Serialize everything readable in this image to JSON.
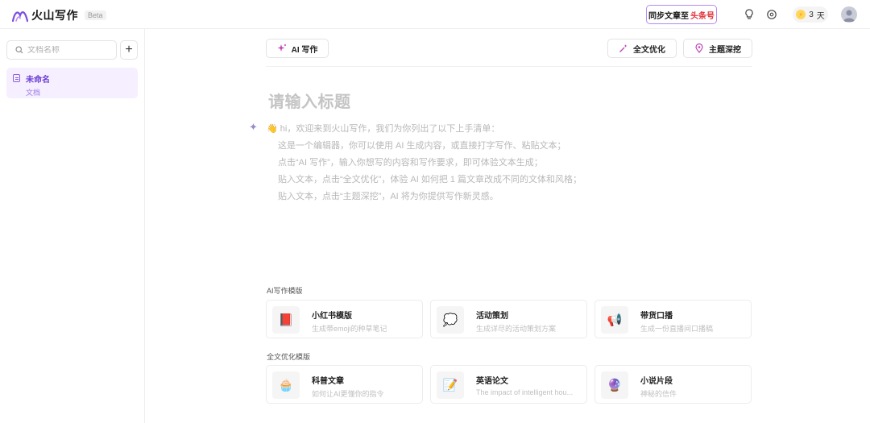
{
  "app": {
    "name": "火山写作",
    "badge": "Beta"
  },
  "header": {
    "sync_label": "同步文章至",
    "sync_target": "头条号",
    "days_count": "3",
    "days_unit": "天"
  },
  "sidebar": {
    "search_placeholder": "文档名称",
    "add_label": "+",
    "docs": [
      {
        "title": "未命名",
        "subtitle": "文档"
      }
    ]
  },
  "toolbar": {
    "ai_write": "AI 写作",
    "optimize": "全文优化",
    "topic": "主题深挖"
  },
  "editor": {
    "title_placeholder": "请输入标题",
    "intro_lines": [
      "hi，欢迎来到火山写作，我们为你列出了以下上手清单：",
      "这是一个编辑器，你可以使用 AI 生成内容，或直接打字写作、粘贴文本；",
      "点击“AI 写作”，输入你想写的内容和写作要求，即可体验文本生成；",
      "贴入文本，点击“全文优化”，体验 AI 如何把 1 篇文章改成不同的文体和风格；",
      "贴入文本，点击“主题深挖”，AI 将为你提供写作新灵感。"
    ]
  },
  "templates": {
    "ai_section": "AI写作模版",
    "ai_cards": [
      {
        "title": "小红书模版",
        "desc": "生成带emoji的种草笔记",
        "icon": "red-book-icon"
      },
      {
        "title": "活动策划",
        "desc": "生成详尽的活动策划方案",
        "icon": "chat-bubble-icon"
      },
      {
        "title": "带货口播",
        "desc": "生成一份直播间口播稿",
        "icon": "megaphone-icon"
      }
    ],
    "opt_section": "全文优化模版",
    "opt_cards": [
      {
        "title": "科普文章",
        "desc": "如何让AI更懂你的指令",
        "icon": "science-icon"
      },
      {
        "title": "英语论文",
        "desc": "The impact of intelligent hou...",
        "icon": "memo-icon"
      },
      {
        "title": "小说片段",
        "desc": "神秘的信件",
        "icon": "crystal-ball-icon"
      }
    ]
  },
  "colors": {
    "accent": "#8a5ce6",
    "brand_red": "#e2323c",
    "selected_bg": "#f6efff"
  }
}
